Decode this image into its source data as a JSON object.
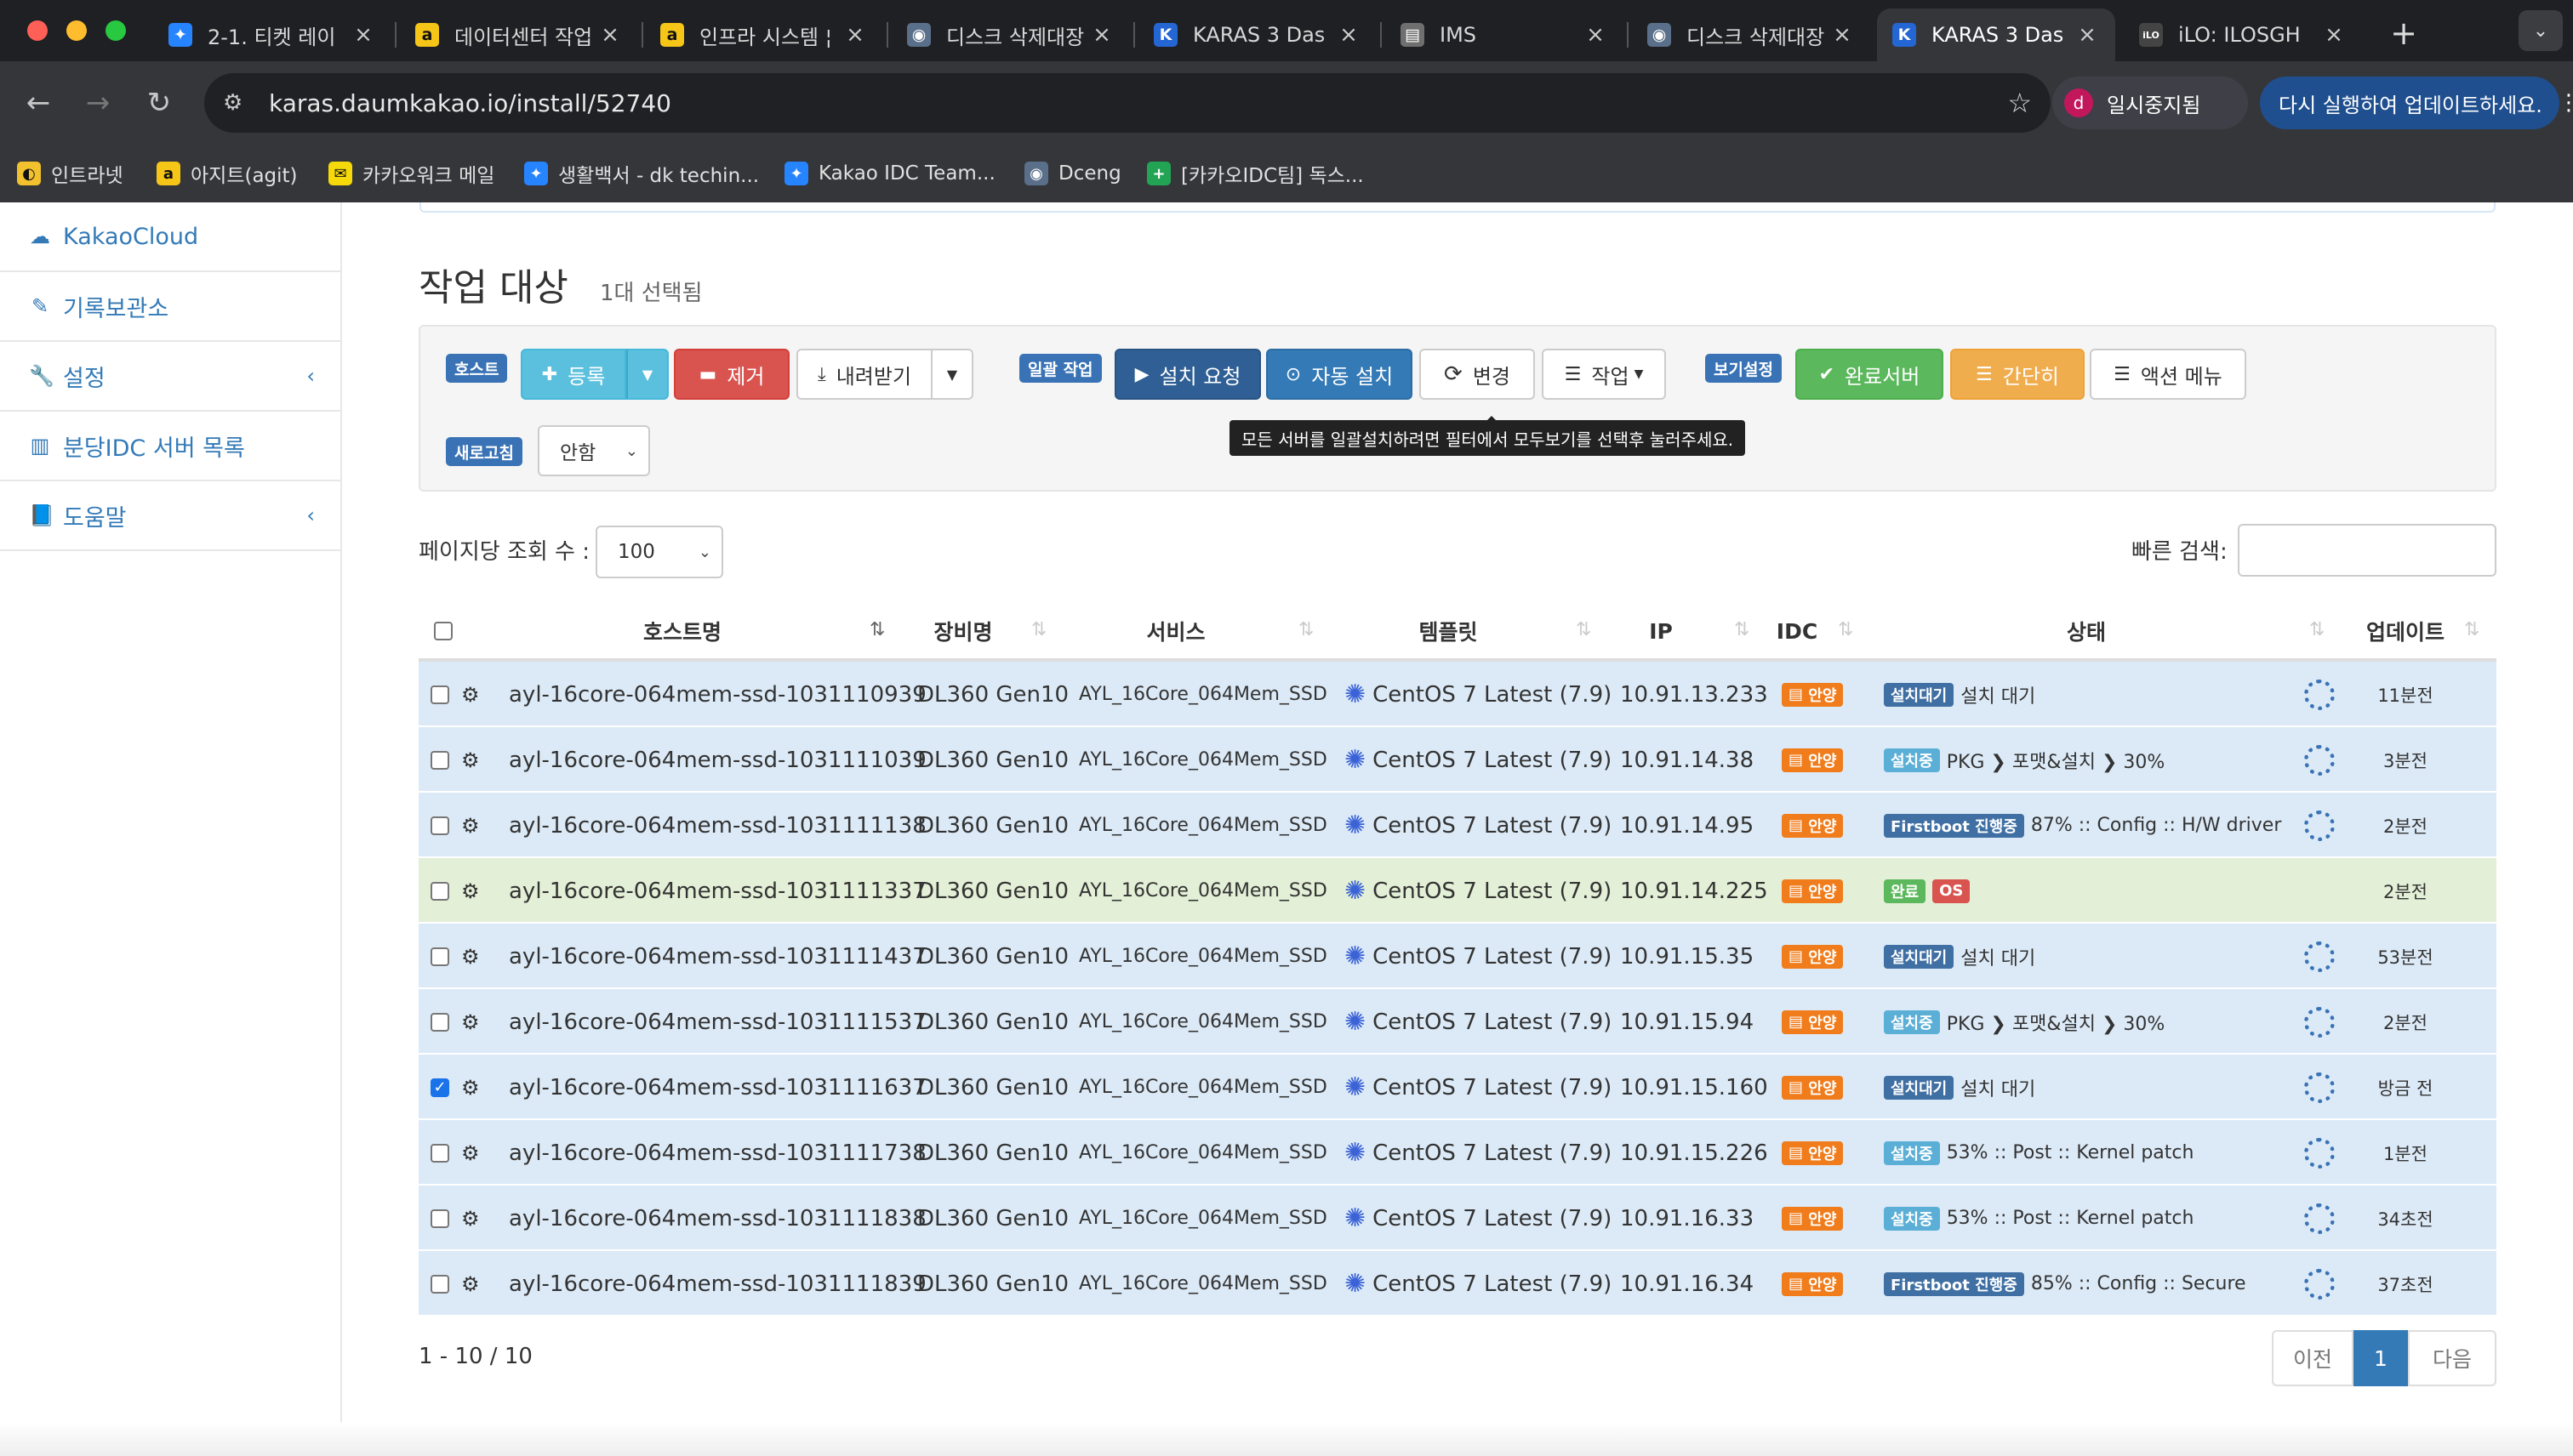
{
  "browser": {
    "tabs": [
      {
        "title": "2-1. 티켓 레이",
        "icon": "jira-icon",
        "fav": "✦",
        "favbg": "#2684ff"
      },
      {
        "title": "데이터센터 작업",
        "icon": "agit-icon",
        "fav": "a",
        "favbg": "#f5c518"
      },
      {
        "title": "인프라 시스템 ¦",
        "icon": "agit-icon",
        "fav": "a",
        "favbg": "#f5c518"
      },
      {
        "title": "디스크 삭제대장",
        "icon": "globe-icon",
        "fav": "◉",
        "favbg": "#5a6f8a"
      },
      {
        "title": "KARAS 3 Das",
        "icon": "karas-icon",
        "fav": "K",
        "favbg": "#2466d4"
      },
      {
        "title": "IMS",
        "icon": "doc-icon",
        "fav": "▤",
        "favbg": "#6f6f6f"
      },
      {
        "title": "디스크 삭제대장",
        "icon": "globe-icon",
        "fav": "◉",
        "favbg": "#5a6f8a"
      },
      {
        "title": "KARAS 3 Das",
        "icon": "karas-icon",
        "fav": "K",
        "favbg": "#2466d4"
      },
      {
        "title": "iLO: ILOSGH",
        "icon": "ilo-icon",
        "fav": "iLO",
        "favbg": "#444"
      }
    ],
    "url": "karas.daumkakao.io/install/52740",
    "profile_label": "일시중지됨",
    "profile_initial": "d",
    "update_label": "다시 실행하여 업데이트하세요.",
    "bookmarks": [
      {
        "label": "인트라넷",
        "fav": "◐",
        "favbg": "#f2c12e"
      },
      {
        "label": "아지트(agit)",
        "fav": "a",
        "favbg": "#f5c518"
      },
      {
        "label": "카카오워크 메일",
        "fav": "✉",
        "favbg": "#f5d90a"
      },
      {
        "label": "생활백서 - dk techin...",
        "fav": "✦",
        "favbg": "#2684ff"
      },
      {
        "label": "Kakao IDC Team...",
        "fav": "✦",
        "favbg": "#2684ff"
      },
      {
        "label": "Dceng",
        "fav": "◉",
        "favbg": "#5a6f8a"
      },
      {
        "label": "[카카오IDC팀] 독스...",
        "fav": "+",
        "favbg": "#23a455"
      }
    ]
  },
  "sidebar": {
    "items": [
      {
        "label": "KakaoCloud",
        "icon": "cloud-icon"
      },
      {
        "label": "기록보관소",
        "icon": "edit-icon"
      },
      {
        "label": "설정",
        "icon": "wrench-icon"
      },
      {
        "label": "분당IDC 서버 목록",
        "icon": "server-icon"
      },
      {
        "label": "도움말",
        "icon": "book-icon"
      }
    ]
  },
  "page": {
    "title": "작업 대상",
    "subtitle": "1대 선택됨"
  },
  "toolbar": {
    "host_label": "호스트",
    "register": "등록",
    "remove": "제거",
    "download": "내려받기",
    "bulk_label": "일괄 작업",
    "install_request": "설치 요청",
    "auto_install": "자동 설치",
    "change": "변경",
    "work": "작업",
    "view_label": "보기설정",
    "done_server": "완료서버",
    "simple": "간단히",
    "action_menu": "액션 메뉴",
    "refresh_label": "새로고침",
    "refresh_value": "안함",
    "tooltip": "모든 서버를 일괄설치하려면 필터에서 모두보기를 선택후 눌러주세요."
  },
  "controls": {
    "per_page_label": "페이지당 조회 수 :",
    "per_page_value": "100",
    "quick_search_label": "빠른 검색:"
  },
  "table": {
    "columns": [
      "호스트명",
      "장비명",
      "서비스",
      "템플릿",
      "IP",
      "IDC",
      "상태",
      "업데이트"
    ],
    "rows": [
      {
        "host": "ayl-16core-064mem-ssd-1031110939",
        "device": "DL360 Gen10",
        "service": "AYL_16Core_064Mem_SSD",
        "template": "CentOS 7 Latest (7.9)",
        "ip": "10.91.13.233",
        "idc": "안양",
        "status_badge": "설치대기",
        "status_text": "설치 대기",
        "update": "11분전"
      },
      {
        "host": "ayl-16core-064mem-ssd-1031111039",
        "device": "DL360 Gen10",
        "service": "AYL_16Core_064Mem_SSD",
        "template": "CentOS 7 Latest (7.9)",
        "ip": "10.91.14.38",
        "idc": "안양",
        "status_badge": "설치중",
        "status_text": "PKG ❯ 포맷&설치 ❯ 30%",
        "update": "3분전"
      },
      {
        "host": "ayl-16core-064mem-ssd-1031111138",
        "device": "DL360 Gen10",
        "service": "AYL_16Core_064Mem_SSD",
        "template": "CentOS 7 Latest (7.9)",
        "ip": "10.91.14.95",
        "idc": "안양",
        "status_badge": "Firstboot 진행중",
        "status_text": "87% :: Config :: H/W driver",
        "update": "2분전"
      },
      {
        "host": "ayl-16core-064mem-ssd-1031111337",
        "device": "DL360 Gen10",
        "service": "AYL_16Core_064Mem_SSD",
        "template": "CentOS 7 Latest (7.9)",
        "ip": "10.91.14.225",
        "idc": "안양",
        "status_badge": "완료",
        "status_badge2": "OS",
        "status_text": "",
        "update": "2분전"
      },
      {
        "host": "ayl-16core-064mem-ssd-1031111437",
        "device": "DL360 Gen10",
        "service": "AYL_16Core_064Mem_SSD",
        "template": "CentOS 7 Latest (7.9)",
        "ip": "10.91.15.35",
        "idc": "안양",
        "status_badge": "설치대기",
        "status_text": "설치 대기",
        "update": "53분전"
      },
      {
        "host": "ayl-16core-064mem-ssd-1031111537",
        "device": "DL360 Gen10",
        "service": "AYL_16Core_064Mem_SSD",
        "template": "CentOS 7 Latest (7.9)",
        "ip": "10.91.15.94",
        "idc": "안양",
        "status_badge": "설치중",
        "status_text": "PKG ❯ 포맷&설치 ❯ 30%",
        "update": "2분전"
      },
      {
        "host": "ayl-16core-064mem-ssd-1031111637",
        "device": "DL360 Gen10",
        "service": "AYL_16Core_064Mem_SSD",
        "template": "CentOS 7 Latest (7.9)",
        "ip": "10.91.15.160",
        "idc": "안양",
        "status_badge": "설치대기",
        "status_text": "설치 대기",
        "update": "방금 전"
      },
      {
        "host": "ayl-16core-064mem-ssd-1031111738",
        "device": "DL360 Gen10",
        "service": "AYL_16Core_064Mem_SSD",
        "template": "CentOS 7 Latest (7.9)",
        "ip": "10.91.15.226",
        "idc": "안양",
        "status_badge": "설치중",
        "status_text": "53% :: Post :: Kernel patch",
        "update": "1분전"
      },
      {
        "host": "ayl-16core-064mem-ssd-1031111838",
        "device": "DL360 Gen10",
        "service": "AYL_16Core_064Mem_SSD",
        "template": "CentOS 7 Latest (7.9)",
        "ip": "10.91.16.33",
        "idc": "안양",
        "status_badge": "설치중",
        "status_text": "53% :: Post :: Kernel patch",
        "update": "34초전"
      },
      {
        "host": "ayl-16core-064mem-ssd-1031111839",
        "device": "DL360 Gen10",
        "service": "AYL_16Core_064Mem_SSD",
        "template": "CentOS 7 Latest (7.9)",
        "ip": "10.91.16.34",
        "idc": "안양",
        "status_badge": "Firstboot 진행중",
        "status_text": "85% :: Config :: Secure",
        "update": "37초전"
      }
    ]
  },
  "footer": {
    "summary": "1 - 10 / 10",
    "prev": "이전",
    "page": "1",
    "next": "다음"
  }
}
